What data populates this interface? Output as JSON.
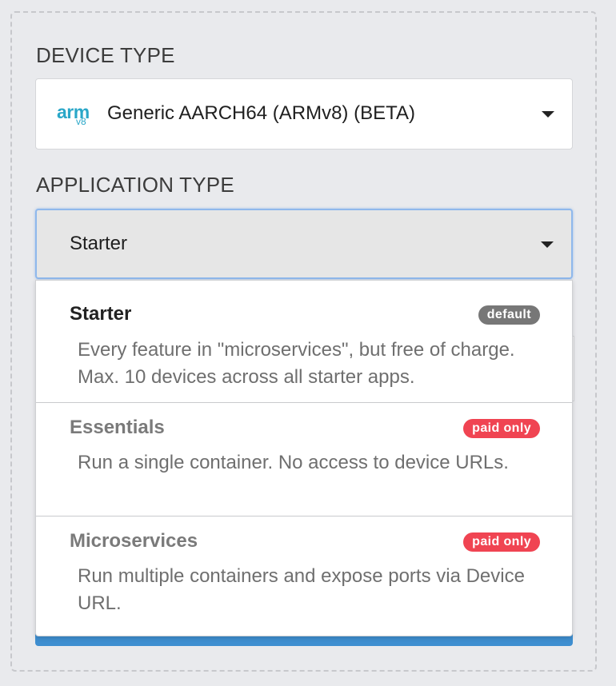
{
  "device_type": {
    "label": "DEVICE TYPE",
    "selected": "Generic AARCH64 (ARMv8) (BETA)",
    "logo_text": "arm",
    "logo_sub": "v8",
    "icon": "arm-logo"
  },
  "application_type": {
    "label": "APPLICATION TYPE",
    "selected": "Starter",
    "options": [
      {
        "title": "Starter",
        "badge": "default",
        "description": "Every feature in \"microservices\", but free of charge. Max. 10 devices across all starter apps.",
        "state": "selectable"
      },
      {
        "title": "Essentials",
        "badge": "paid only",
        "description": "Run a single container. No access to device URLs.",
        "state": "disabled"
      },
      {
        "title": "Microservices",
        "badge": "paid only",
        "description": "Run multiple containers and expose ports via Device URL.",
        "state": "disabled"
      }
    ]
  },
  "colors": {
    "default_badge": "#777777",
    "paid_badge": "#f04452",
    "focus_border": "#8fb8ec",
    "arm_brand": "#2aa7c8",
    "primary_button": "#3e8ed0"
  }
}
